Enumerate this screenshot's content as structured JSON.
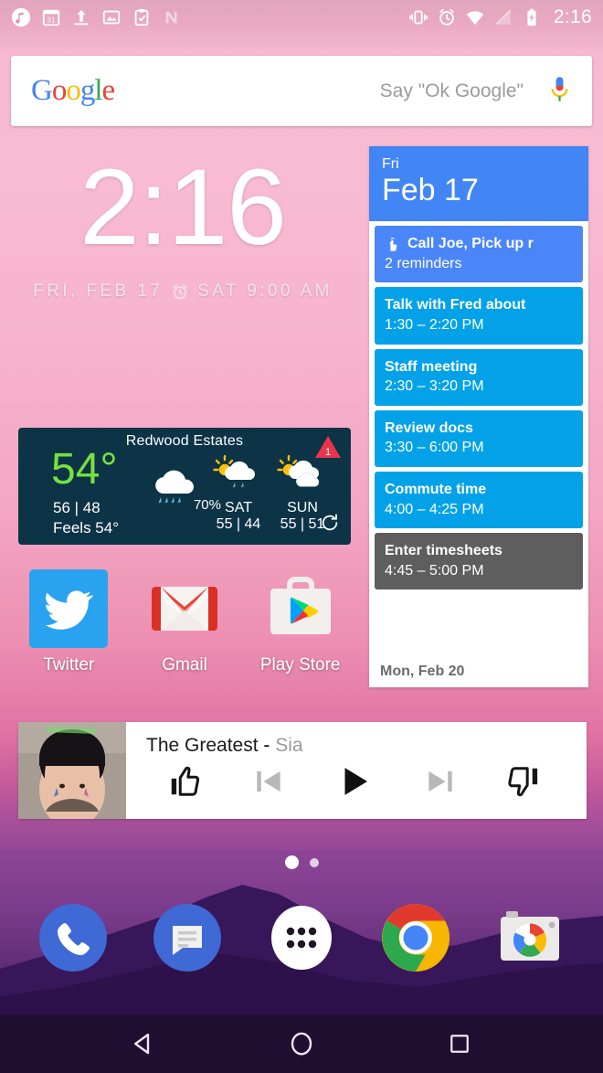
{
  "status_bar": {
    "clock": "2:16",
    "left_icons": [
      "music-note-icon",
      "calendar-31-icon",
      "upload-icon",
      "photos-icon",
      "clipboard-check-icon",
      "nova-n-icon"
    ],
    "right_icons": [
      "vibrate-icon",
      "alarm-icon",
      "wifi-icon",
      "no-signal-icon",
      "battery-charging-icon"
    ]
  },
  "search": {
    "logo_letters": [
      "G",
      "o",
      "o",
      "g",
      "l",
      "e"
    ],
    "hint": "Say \"Ok Google\"",
    "mic_icon": "microphone-icon"
  },
  "clock_widget": {
    "time": "2:16",
    "date": "FRI, FEB 17",
    "alarm_icon": "alarm-clock-icon",
    "alarm": "SAT 9:00 AM"
  },
  "calendar_widget": {
    "header_dow": "Fri",
    "header_date": "Feb 17",
    "header_color": "#4285F4",
    "next_day": "Mon, Feb 20",
    "events": [
      {
        "title": "Call Joe, Pick up r",
        "sub": "2 reminders",
        "color": "#4a86f7",
        "icon": "finger-string-reminder-icon",
        "is_reminder": true
      },
      {
        "title": "Talk with Fred about",
        "sub": "1:30 – 2:20 PM",
        "color": "#03a2e8",
        "is_reminder": false
      },
      {
        "title": "Staff meeting",
        "sub": "2:30 – 3:20 PM",
        "color": "#03a2e8",
        "is_reminder": false
      },
      {
        "title": "Review docs",
        "sub": "3:30 – 6:00 PM",
        "color": "#03a2e8",
        "is_reminder": false
      },
      {
        "title": "Commute time",
        "sub": "4:00 – 4:25 PM",
        "color": "#03a2e8",
        "is_reminder": false
      },
      {
        "title": "Enter timesheets",
        "sub": "4:45 – 5:00 PM",
        "color": "#5e5e5e",
        "is_reminder": false
      }
    ]
  },
  "weather_widget": {
    "city": "Redwood Estates",
    "temp": "54°",
    "temp_color": "#76e23e",
    "hi_lo": "56 | 48",
    "feels": "Feels 54°",
    "precip": "70%",
    "today_icon": "rain-cloud-icon",
    "alert_badge": "1",
    "alert_color": "#e8344e",
    "refresh_icon": "refresh-icon",
    "forecast": [
      {
        "day": "SAT",
        "hi_lo": "55 | 44",
        "icon": "sun-rain-cloud-icon"
      },
      {
        "day": "SUN",
        "hi_lo": "55 | 51",
        "icon": "sun-cloud-icon"
      }
    ],
    "background": "#0d3347"
  },
  "apps": [
    {
      "label": "Twitter",
      "icon": "twitter-icon"
    },
    {
      "label": "Gmail",
      "icon": "gmail-icon"
    },
    {
      "label": "Play Store",
      "icon": "play-store-icon"
    }
  ],
  "music_widget": {
    "title": "The Greatest",
    "separator": " - ",
    "artist": "Sia",
    "album_art": "album-art-sia-portrait",
    "controls": [
      {
        "name": "thumbs-up-icon",
        "state": "active"
      },
      {
        "name": "previous-track-icon",
        "state": "disabled"
      },
      {
        "name": "play-icon",
        "state": "active"
      },
      {
        "name": "next-track-icon",
        "state": "disabled"
      },
      {
        "name": "thumbs-down-icon",
        "state": "active"
      }
    ]
  },
  "page_indicator": {
    "pages": 2,
    "active": 1
  },
  "dock": [
    {
      "label": "Phone",
      "icon": "phone-icon"
    },
    {
      "label": "Messages",
      "icon": "messages-icon"
    },
    {
      "label": "All apps",
      "icon": "app-drawer-icon"
    },
    {
      "label": "Chrome",
      "icon": "chrome-icon"
    },
    {
      "label": "Camera",
      "icon": "camera-icon"
    }
  ],
  "nav_bar": [
    {
      "label": "Back",
      "icon": "back-triangle-icon"
    },
    {
      "label": "Home",
      "icon": "home-circle-icon"
    },
    {
      "label": "Recents",
      "icon": "recents-square-icon"
    }
  ]
}
